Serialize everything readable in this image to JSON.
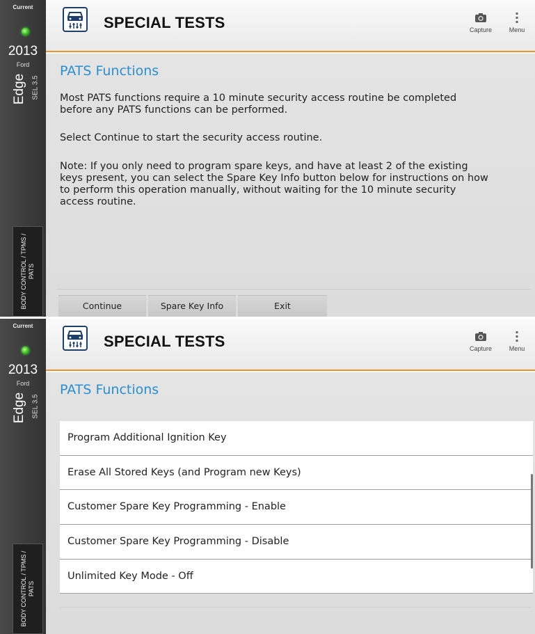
{
  "screens": [
    {
      "sidebar": {
        "current_label": "Current",
        "year": "2013",
        "make": "Ford",
        "model": "Edge",
        "trim": "SEL 3.5",
        "module": "BODY CONTROL / TPMS / PATS"
      },
      "header": {
        "title": "SPECIAL TESTS",
        "capture_label": "Capture",
        "menu_label": "Menu",
        "icon": "car-diagnostic-icon"
      },
      "section_title": "PATS Functions",
      "paragraphs": [
        "Most PATS functions require a 10 minute security access routine be completed before any PATS functions can be performed.",
        "Select Continue to start the security access routine.",
        "Note: If you only need to program spare keys, and have at least 2 of the existing keys present, you can select the Spare Key Info button below for instructions on how to perform this operation manually, without waiting for the 10 minute security access routine."
      ],
      "buttons": [
        "Continue",
        "Spare Key Info",
        "Exit"
      ]
    },
    {
      "sidebar": {
        "current_label": "Current",
        "year": "2013",
        "make": "Ford",
        "model": "Edge",
        "trim": "SEL 3.5",
        "module": "BODY CONTROL / TPMS / PATS"
      },
      "header": {
        "title": "SPECIAL TESTS",
        "capture_label": "Capture",
        "menu_label": "Menu",
        "icon": "car-diagnostic-icon"
      },
      "section_title": "PATS Functions",
      "list": [
        "Program Additional Ignition Key",
        "Erase All Stored Keys (and Program new Keys)",
        "Customer Spare Key Programming - Enable",
        "Customer Spare Key Programming - Disable",
        "Unlimited Key Mode - Off"
      ]
    }
  ],
  "colors": {
    "accent_orange": "#f0922a",
    "title_blue": "#2a8fd0",
    "status_led_green": "#3fbf2a"
  }
}
